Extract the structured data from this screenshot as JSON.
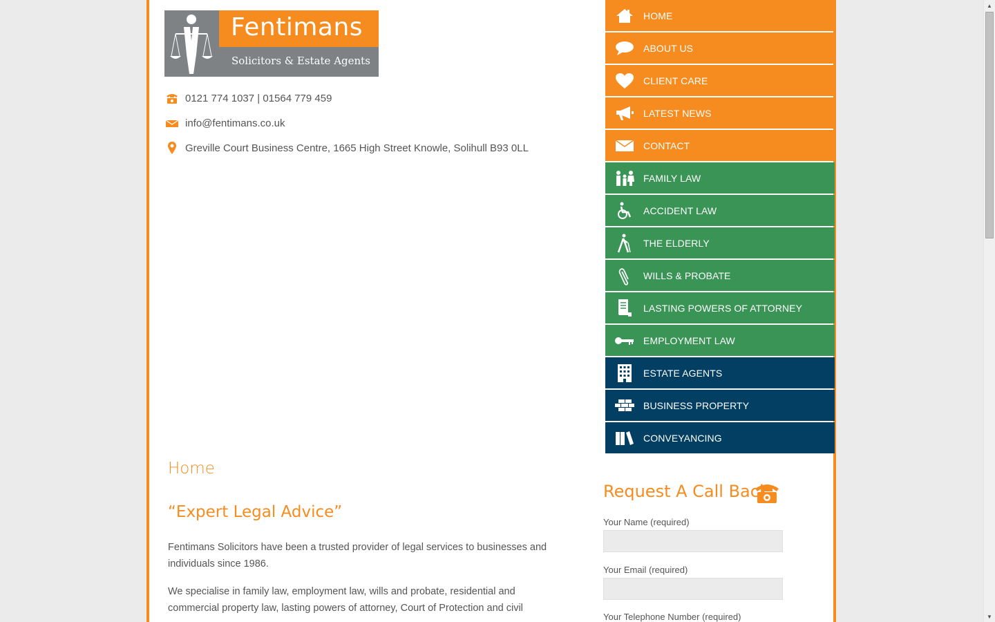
{
  "logo": {
    "brand": "Fentimans",
    "tagline": "Solicitors & Estate Agents"
  },
  "contact": {
    "phone": "0121 774 1037 | 01564 779 459",
    "email": "info@fentimans.co.uk",
    "address": "Greville Court Business Centre, 1665 High Street Knowle, Solihull B93 0LL"
  },
  "nav": {
    "items": [
      {
        "label": "HOME",
        "icon": "home-icon",
        "color": "#f68c1f"
      },
      {
        "label": "ABOUT US",
        "icon": "speech-bubble-icon",
        "color": "#f68c1f"
      },
      {
        "label": "CLIENT CARE",
        "icon": "heart-icon",
        "color": "#f68c1f"
      },
      {
        "label": "LATEST NEWS",
        "icon": "megaphone-icon",
        "color": "#f68c1f"
      },
      {
        "label": "CONTACT",
        "icon": "envelope-icon",
        "color": "#f68c1f"
      },
      {
        "label": "FAMILY LAW",
        "icon": "family-icon",
        "color": "#3a9455"
      },
      {
        "label": "ACCIDENT LAW",
        "icon": "wheelchair-icon",
        "color": "#3a9455"
      },
      {
        "label": "THE ELDERLY",
        "icon": "walking-stick-icon",
        "color": "#3a9455"
      },
      {
        "label": "WILLS & PROBATE",
        "icon": "paperclip-icon",
        "color": "#3a9455"
      },
      {
        "label": "LASTING POWERS OF ATTORNEY",
        "icon": "document-icon",
        "color": "#3a9455"
      },
      {
        "label": "EMPLOYMENT LAW",
        "icon": "key-icon",
        "color": "#3a9455"
      },
      {
        "label": "ESTATE AGENTS",
        "icon": "building-icon",
        "color": "#033f63"
      },
      {
        "label": "BUSINESS PROPERTY",
        "icon": "bricks-icon",
        "color": "#033f63"
      },
      {
        "label": "CONVEYANCING",
        "icon": "books-icon",
        "color": "#033f63"
      }
    ]
  },
  "main": {
    "heading": "Home",
    "quote": "“Expert Legal Advice”",
    "para1_line1": "Fentimans Solicitors have been a trusted provider of legal services to businesses and",
    "para1_line2": "individuals since 1986.",
    "para2_line1": "We specialise in family law, employment law, wills and probate, residential and",
    "para2_line2": "commercial property law, lasting powers of attorney, Court of Protection and civil"
  },
  "callback": {
    "title": "Request A Call Back",
    "name_label": "Your Name (required)",
    "email_label": "Your Email (required)",
    "phone_label": "Your Telephone Number (required)"
  },
  "colors": {
    "orange": "#f68c1f",
    "green": "#3a9455",
    "navy": "#033f63"
  }
}
